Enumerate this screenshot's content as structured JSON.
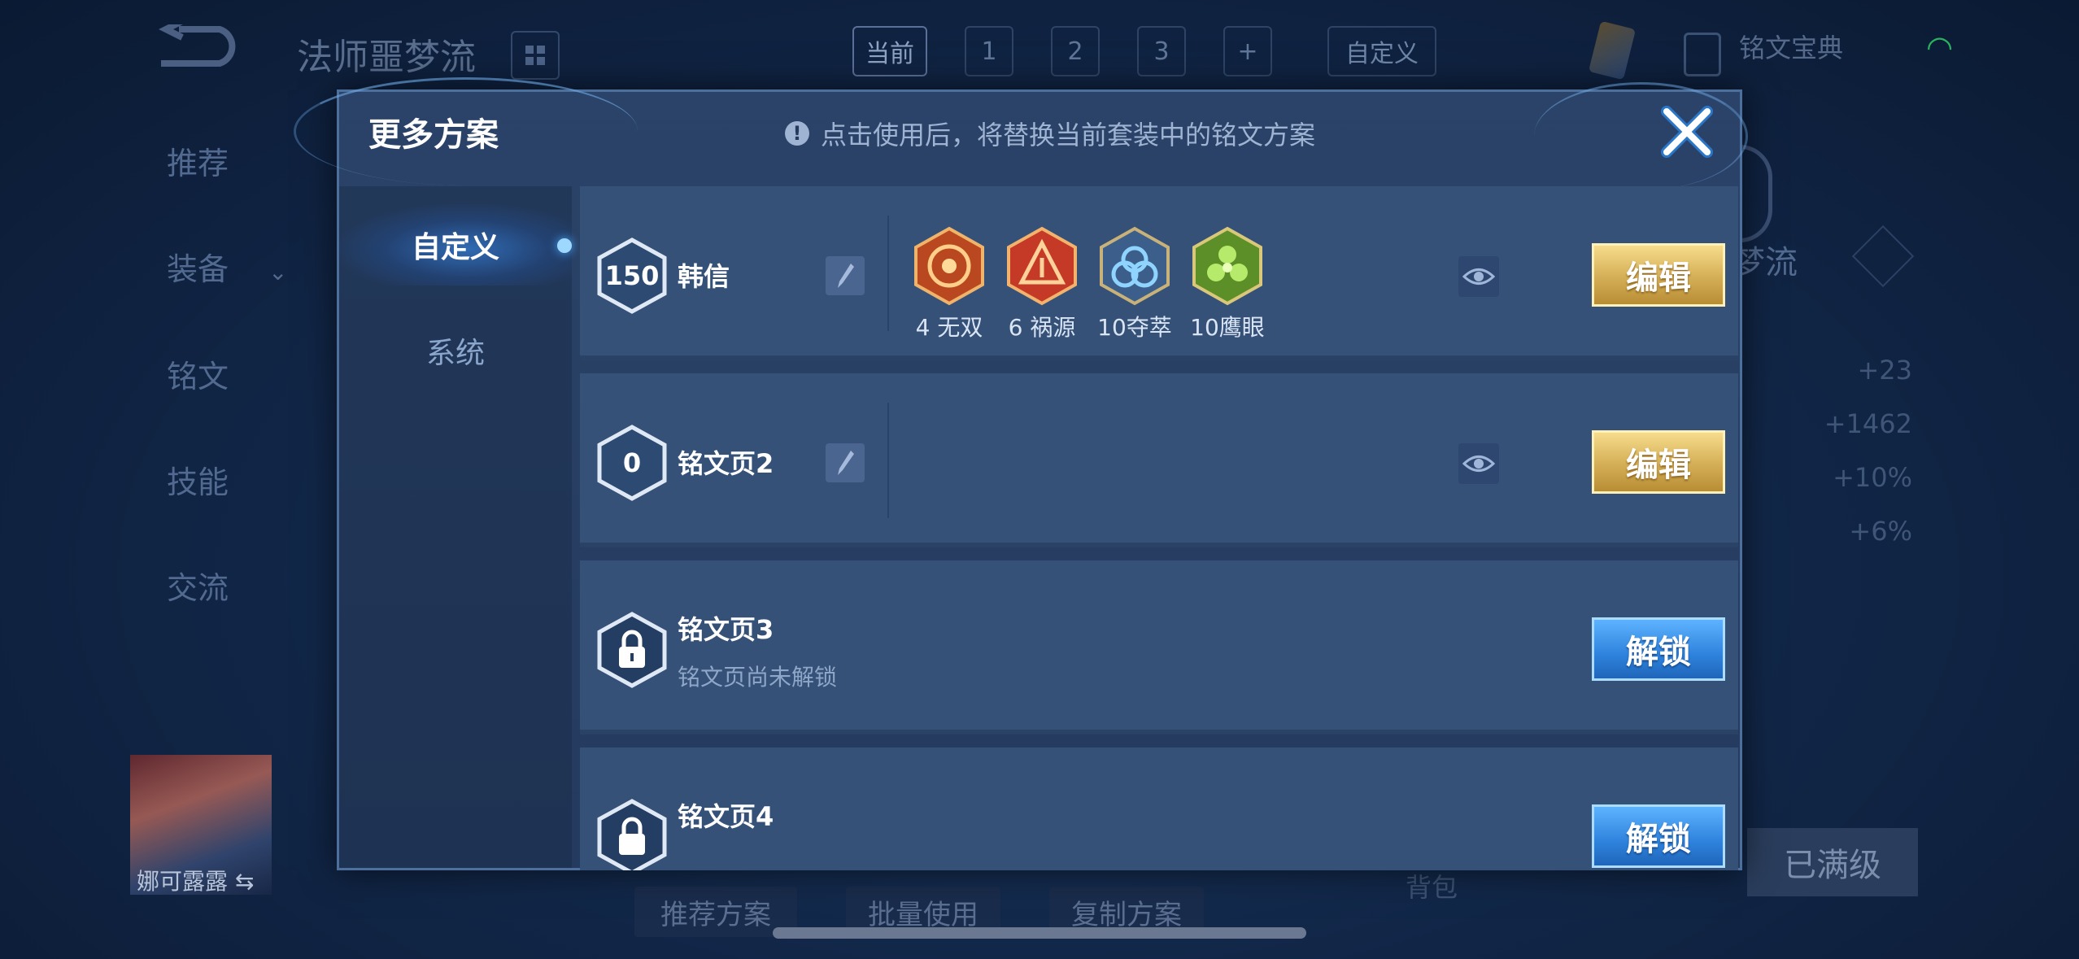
{
  "background": {
    "hero_title": "法师噩梦流",
    "top_tabs": [
      "当前",
      "1",
      "2",
      "3",
      "+"
    ],
    "custom_tab": "自定义",
    "book_label": "铭文宝典",
    "side_nav": [
      "推荐",
      "装备",
      "铭文",
      "技能",
      "交流"
    ],
    "right_stats": [
      "+23",
      "+1462",
      "+10%",
      "+6%"
    ],
    "right_title": "梦流",
    "avatar_name": "娜可露露 ⇆",
    "bottom_buttons": [
      "推荐方案",
      "批量使用",
      "复制方案"
    ],
    "backpack_label": "背包",
    "max_level_label": "已满级"
  },
  "modal": {
    "title": "更多方案",
    "notice": "点击使用后，将替换当前套装中的铭文方案",
    "notice_icon": "!",
    "left_tabs": [
      {
        "label": "自定义",
        "active": true
      },
      {
        "label": "系统",
        "active": false
      }
    ],
    "rows": [
      {
        "level": "150",
        "name": "韩信",
        "locked": false,
        "action": "编辑",
        "runes": [
          {
            "count_label": "4 无双",
            "color": "#c9481f"
          },
          {
            "count_label": "6 祸源",
            "color": "#d2432b"
          },
          {
            "count_label": "10夺萃",
            "color": "#3f8fd0"
          },
          {
            "count_label": "10鹰眼",
            "color": "#6eae2c"
          }
        ]
      },
      {
        "level": "0",
        "name": "铭文页2",
        "locked": false,
        "action": "编辑",
        "runes": []
      },
      {
        "level": "",
        "name": "铭文页3",
        "locked": true,
        "sub": "铭文页尚未解锁",
        "action": "解锁"
      },
      {
        "level": "",
        "name": "铭文页4",
        "locked": true,
        "sub": "",
        "action": "解锁"
      }
    ]
  },
  "colors": {
    "edit_button": "#d7b25a",
    "unlock_button": "#2e82dc",
    "row_bg": "#355178"
  }
}
